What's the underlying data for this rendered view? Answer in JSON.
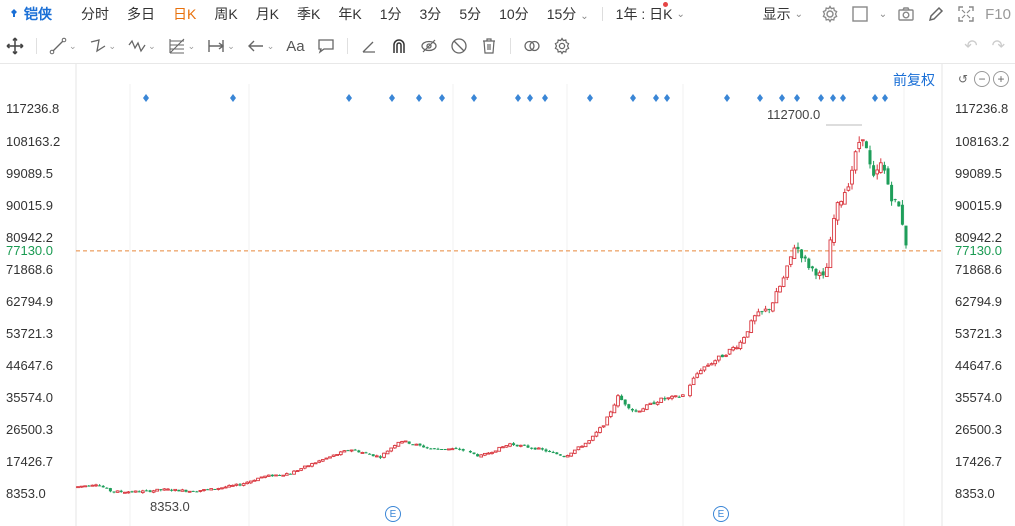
{
  "topbar": {
    "stock_name": "铠侠",
    "tabs": [
      "分时",
      "多日",
      "日K",
      "周K",
      "月K",
      "季K",
      "年K",
      "1分",
      "3分",
      "5分",
      "10分",
      "15分"
    ],
    "active_tab": "日K",
    "range_selector": "1年 : 日K",
    "display_label": "显示",
    "f10_label": "F10"
  },
  "toolbar": {
    "text_tool_label": "Aa"
  },
  "chart": {
    "adjust_label": "前复权",
    "y_labels": [
      "117236.8",
      "108163.2",
      "99089.5",
      "90015.9",
      "80942.2",
      "71868.6",
      "62794.9",
      "53721.3",
      "44647.6",
      "35574.0",
      "26500.3",
      "17426.7",
      "8353.0"
    ],
    "current_price": "77130.0",
    "high_annotation": "112700.0",
    "low_annotation": "8353.0",
    "event_icon_label": "E"
  },
  "chart_data": {
    "type": "candlestick",
    "ylim": [
      8353.0,
      117236.8
    ],
    "current_price": 77130.0,
    "max_price": 112700.0,
    "min_price": 8353.0,
    "colors": {
      "up": "#d9363e",
      "down": "#1e9e5a",
      "marker": "#3a86d6",
      "price_line": "#e8863b"
    }
  }
}
